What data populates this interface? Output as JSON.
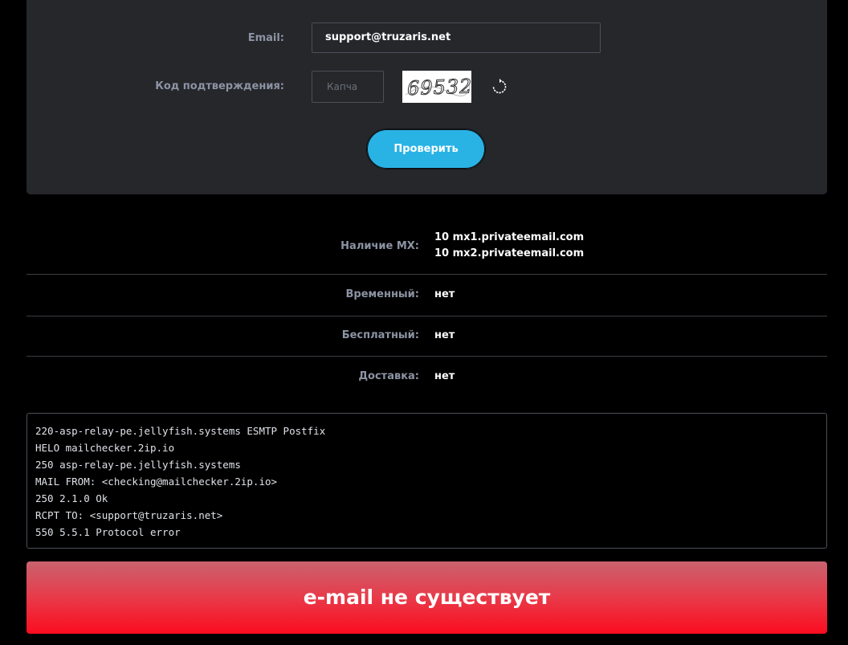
{
  "form": {
    "email_label": "Email:",
    "email_value": "support@truzaris.net",
    "captcha_label": "Код подтверждения:",
    "captcha_placeholder": "Капча",
    "captcha_text": "69532",
    "check_button": "Проверить"
  },
  "results": {
    "mx_label": "Наличие MX:",
    "mx_records": [
      "10 mx1.privateemail.com",
      "10 mx2.privateemail.com"
    ],
    "temporary_label": "Временный:",
    "temporary_value": "нет",
    "free_label": "Бесплатный:",
    "free_value": "нет",
    "delivery_label": "Доставка:",
    "delivery_value": "нет"
  },
  "log": [
    "220-asp-relay-pe.jellyfish.systems ESMTP Postfix",
    "HELO mailchecker.2ip.io",
    "250 asp-relay-pe.jellyfish.systems",
    "MAIL FROM: <checking@mailchecker.2ip.io>",
    "250 2.1.0 Ok",
    "RCPT TO: <support@truzaris.net>",
    "550 5.5.1 Protocol error"
  ],
  "status": {
    "text": "e-mail не существует",
    "color": "#fb0d1f"
  },
  "icons": {
    "refresh": "refresh-icon"
  }
}
